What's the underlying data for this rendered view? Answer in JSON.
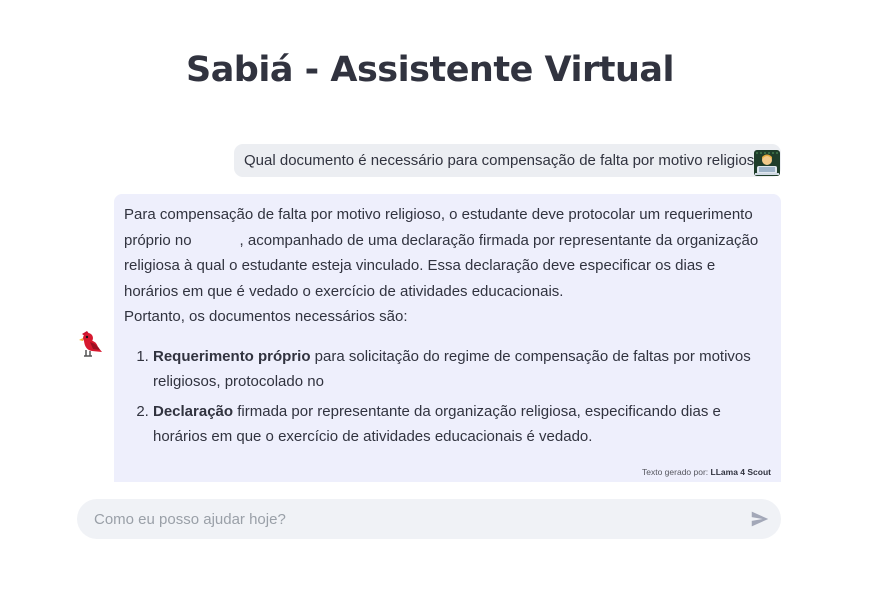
{
  "header": {
    "title": "Sabiá - Assistente Virtual"
  },
  "chat": {
    "user_message": "Qual documento é necessário para compensação de falta por motivo religioso?",
    "user_avatar_icon": "person-at-laptop-icon",
    "bot_avatar_icon": "red-bird-icon",
    "bot_message": {
      "intro_part1": "Para compensação de falta por motivo religioso, o estudante deve protocolar um requerimento próprio no",
      "intro_part2": ", acompanhado de uma declaração firmada por representante da organização religiosa à qual o estudante esteja vinculado. Essa declaração deve especificar os dias e horários em que é vedado o exercício de atividades educacionais.",
      "summary": "Portanto, os documentos necessários são:",
      "items": [
        {
          "bold": "Requerimento próprio",
          "text": " para solicitação do regime de compensação de faltas por motivos religiosos, protocolado no"
        },
        {
          "bold": "Declaração",
          "text": " firmada por representante da organização religiosa, especificando dias e horários em que o exercício de atividades educacionais é vedado."
        }
      ],
      "credit_prefix": "Texto gerado por:",
      "credit_model": "LLama 4 Scout"
    }
  },
  "input": {
    "placeholder": "Como eu posso ajudar hoje?",
    "value": "",
    "send_icon": "send-icon"
  },
  "colors": {
    "user_bubble": "#eceef2",
    "bot_bubble": "#eeeffc",
    "input_bg": "#f0f2f6",
    "text": "#31333f"
  }
}
